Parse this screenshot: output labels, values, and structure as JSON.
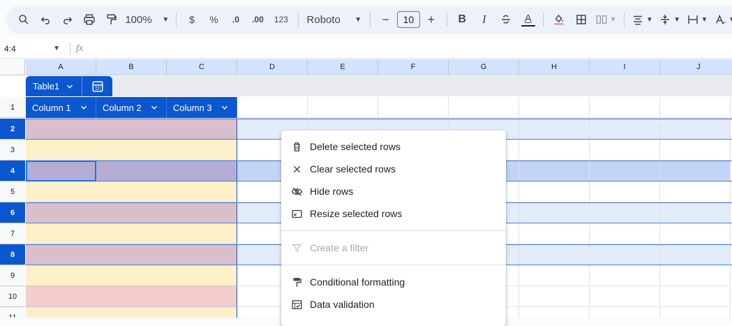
{
  "toolbar": {
    "zoom": "100%",
    "currency": "$",
    "percent": "%",
    "dec_decrease": ".0",
    "dec_increase": ".00",
    "format_more": "123",
    "font": "Roboto",
    "minus": "−",
    "font_size": "10",
    "plus": "+",
    "bold": "B",
    "italic": "I",
    "text_color": "A"
  },
  "formula_bar": {
    "cell_ref": "4:4",
    "fx": "fx"
  },
  "columns": [
    "A",
    "B",
    "C",
    "D",
    "E",
    "F",
    "G",
    "H",
    "I",
    "J"
  ],
  "rows": [
    "1",
    "2",
    "3",
    "4",
    "5",
    "6",
    "7",
    "8",
    "9",
    "10",
    "11"
  ],
  "table": {
    "name": "Table1",
    "headers": [
      "Column 1",
      "Column 2",
      "Column 3"
    ]
  },
  "context_menu": {
    "items": [
      {
        "label": "Delete selected rows",
        "icon": "trash-icon",
        "enabled": true
      },
      {
        "label": "Clear selected rows",
        "icon": "close-icon",
        "enabled": true
      },
      {
        "label": "Hide rows",
        "icon": "eye-off-icon",
        "enabled": true
      },
      {
        "label": "Resize selected rows",
        "icon": "resize-icon",
        "enabled": true
      },
      {
        "label": "Create a filter",
        "icon": "filter-icon",
        "enabled": false
      },
      {
        "label": "Conditional formatting",
        "icon": "paint-roller-icon",
        "enabled": true
      },
      {
        "label": "Data validation",
        "icon": "data-validation-icon",
        "enabled": true
      }
    ]
  },
  "colors": {
    "accent": "#0b57d0",
    "row_mauve": "#d9bfcc",
    "row_yellow": "#fcf0c8",
    "row_pink": "#f4cccc",
    "row_selected": "#b4aed4",
    "selection_tint": "#e3ecfa",
    "selection_tint_active": "#c2d4f6"
  }
}
